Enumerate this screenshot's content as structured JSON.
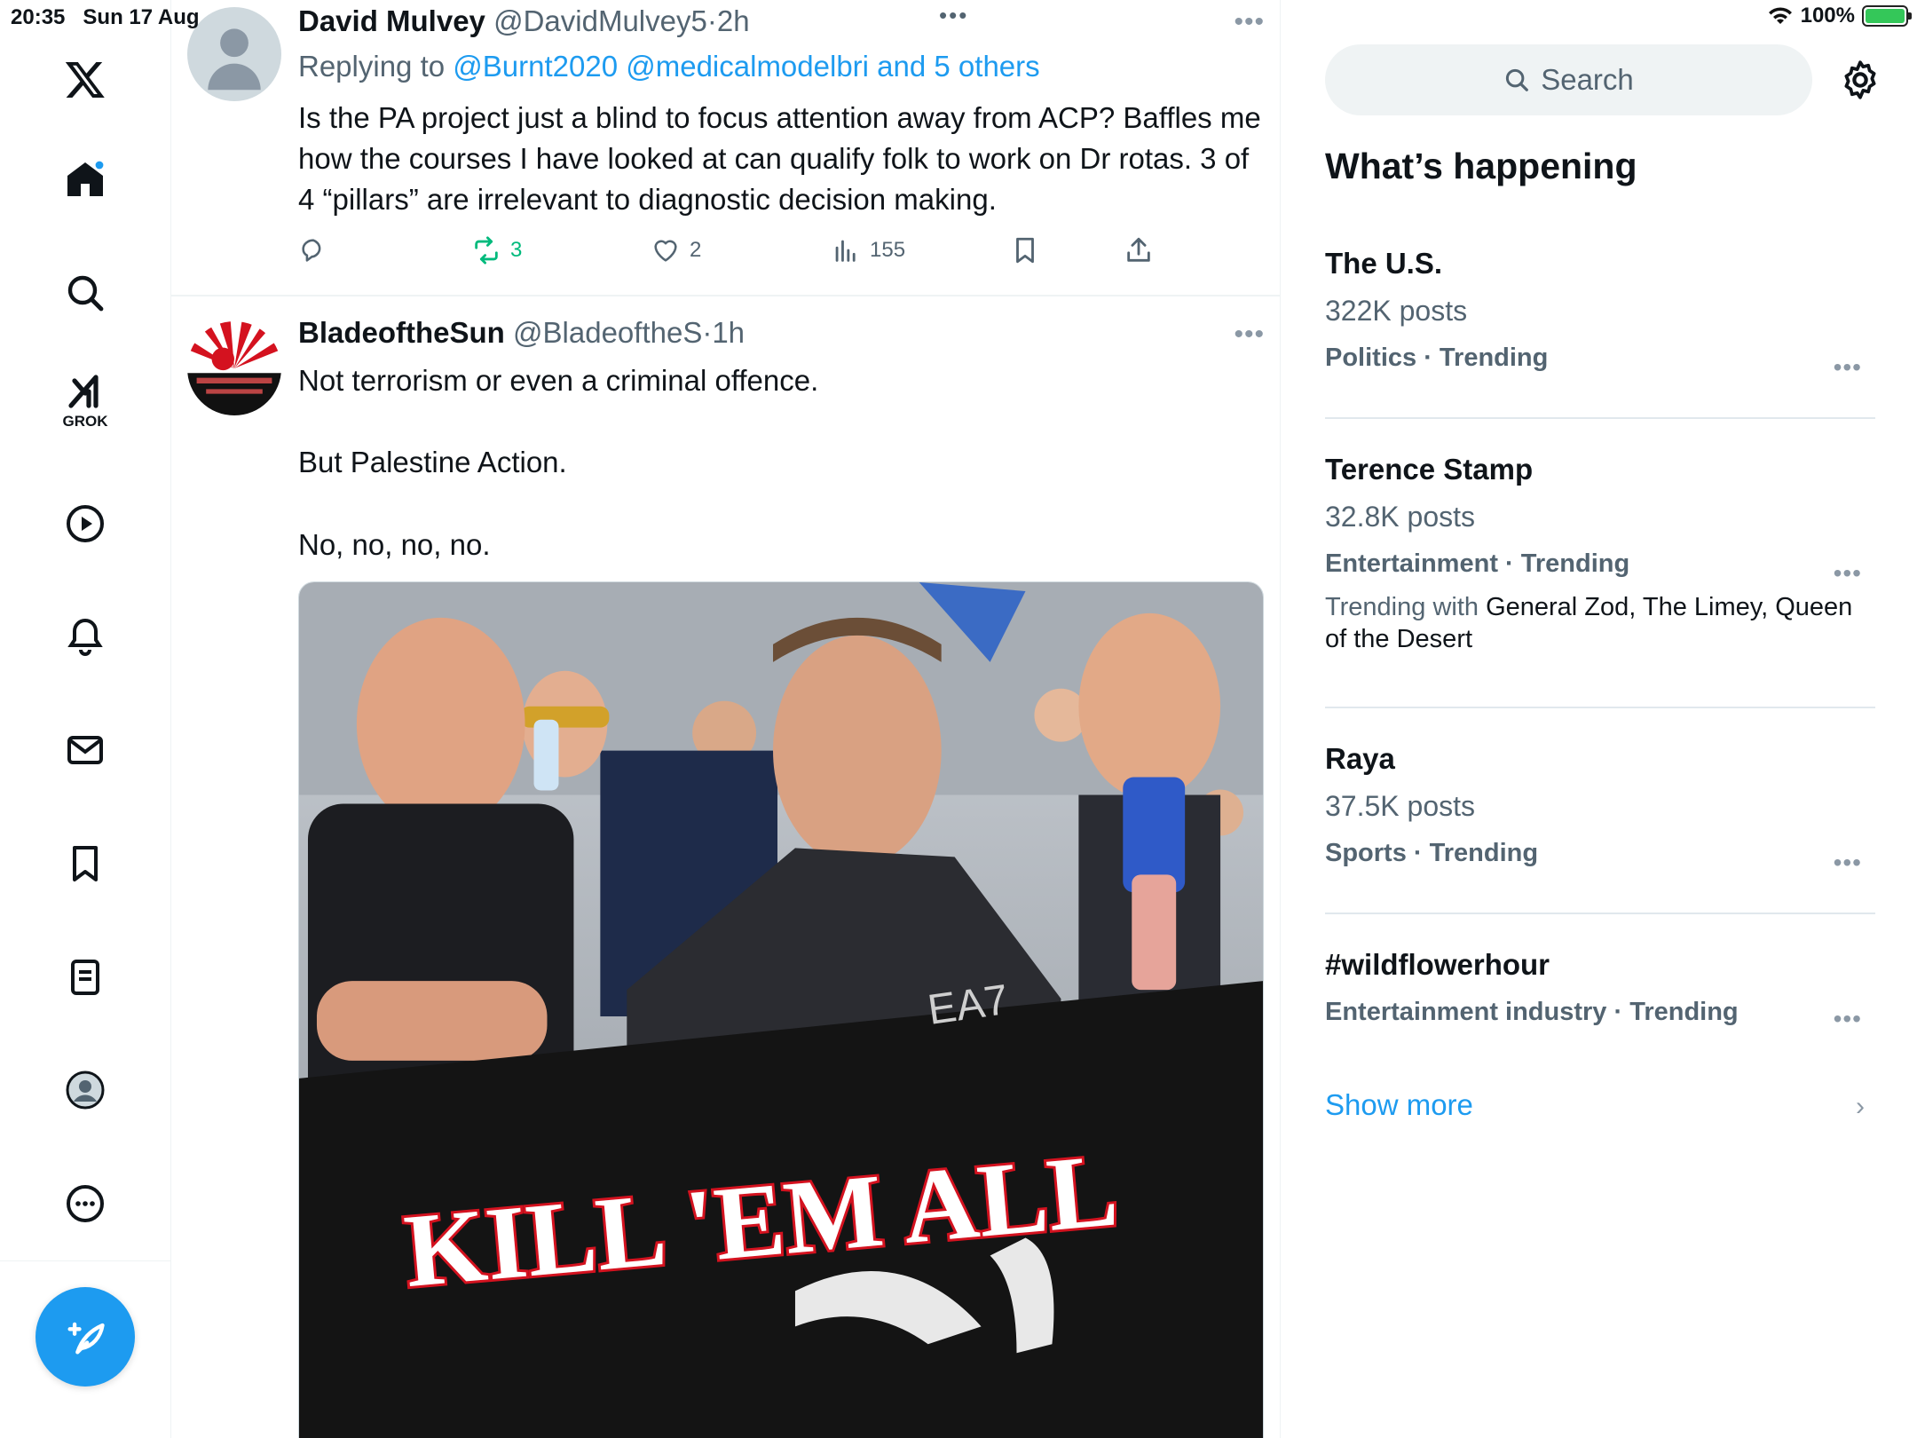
{
  "status": {
    "time": "20:35",
    "date": "Sun 17 Aug",
    "battery": "100%"
  },
  "nav": {
    "grok_label": "GROK"
  },
  "tweets": [
    {
      "name": "David Mulvey",
      "handle": "@DavidMulvey5",
      "time": "2h",
      "reply_prefix": "Replying to",
      "reply_to": "@Burnt2020 @medicalmodelbri and 5 others",
      "text": "Is the PA project just a blind to focus attention away from ACP? Baffles me how the courses I have looked at can qualify folk to work on Dr rotas. 3 of 4 “pillars” are irrelevant to diagnostic decision making.",
      "retweets": "3",
      "likes": "2",
      "views": "155"
    },
    {
      "name": "BladeoftheSun",
      "handle": "@BladeoftheS",
      "time": "1h",
      "text_lines": [
        "Not terrorism or even a criminal offence.",
        "But Palestine Action.",
        "No, no, no, no."
      ],
      "banner_text": "KILL 'EM ALL",
      "shirt_text": "EA7"
    }
  ],
  "sidebar": {
    "search_placeholder": "Search",
    "title": "What’s happening",
    "trends": [
      {
        "name": "The U.S.",
        "posts": "322K posts",
        "category": "Politics · Trending"
      },
      {
        "name": "Terence Stamp",
        "posts": "32.8K posts",
        "category": "Entertainment · Trending",
        "with_prefix": "Trending with",
        "with_names": "General Zod, The Limey, Queen of the Desert"
      },
      {
        "name": "Raya",
        "posts": "37.5K posts",
        "category": "Sports · Trending"
      },
      {
        "name": "#wildflowerhour",
        "category": "Entertainment industry · Trending"
      }
    ],
    "show_more": "Show more"
  },
  "colors": {
    "accent": "#1d9bf0",
    "retweet": "#00ba7c",
    "muted": "#536471"
  }
}
